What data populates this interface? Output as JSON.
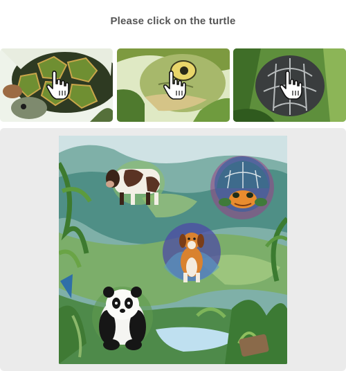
{
  "instruction": "Please click on the turtle",
  "examples": [
    {
      "subject": "turtle",
      "cursor_icon": "hand-pointer-icon"
    },
    {
      "subject": "turtle",
      "cursor_icon": "hand-pointer-icon"
    },
    {
      "subject": "turtle",
      "cursor_icon": "hand-pointer-icon"
    }
  ],
  "challenge": {
    "subjects": [
      "cow",
      "turtle",
      "dog",
      "panda"
    ]
  },
  "colors": {
    "instruction_text": "#555555",
    "panel_background": "#ebebeb"
  }
}
